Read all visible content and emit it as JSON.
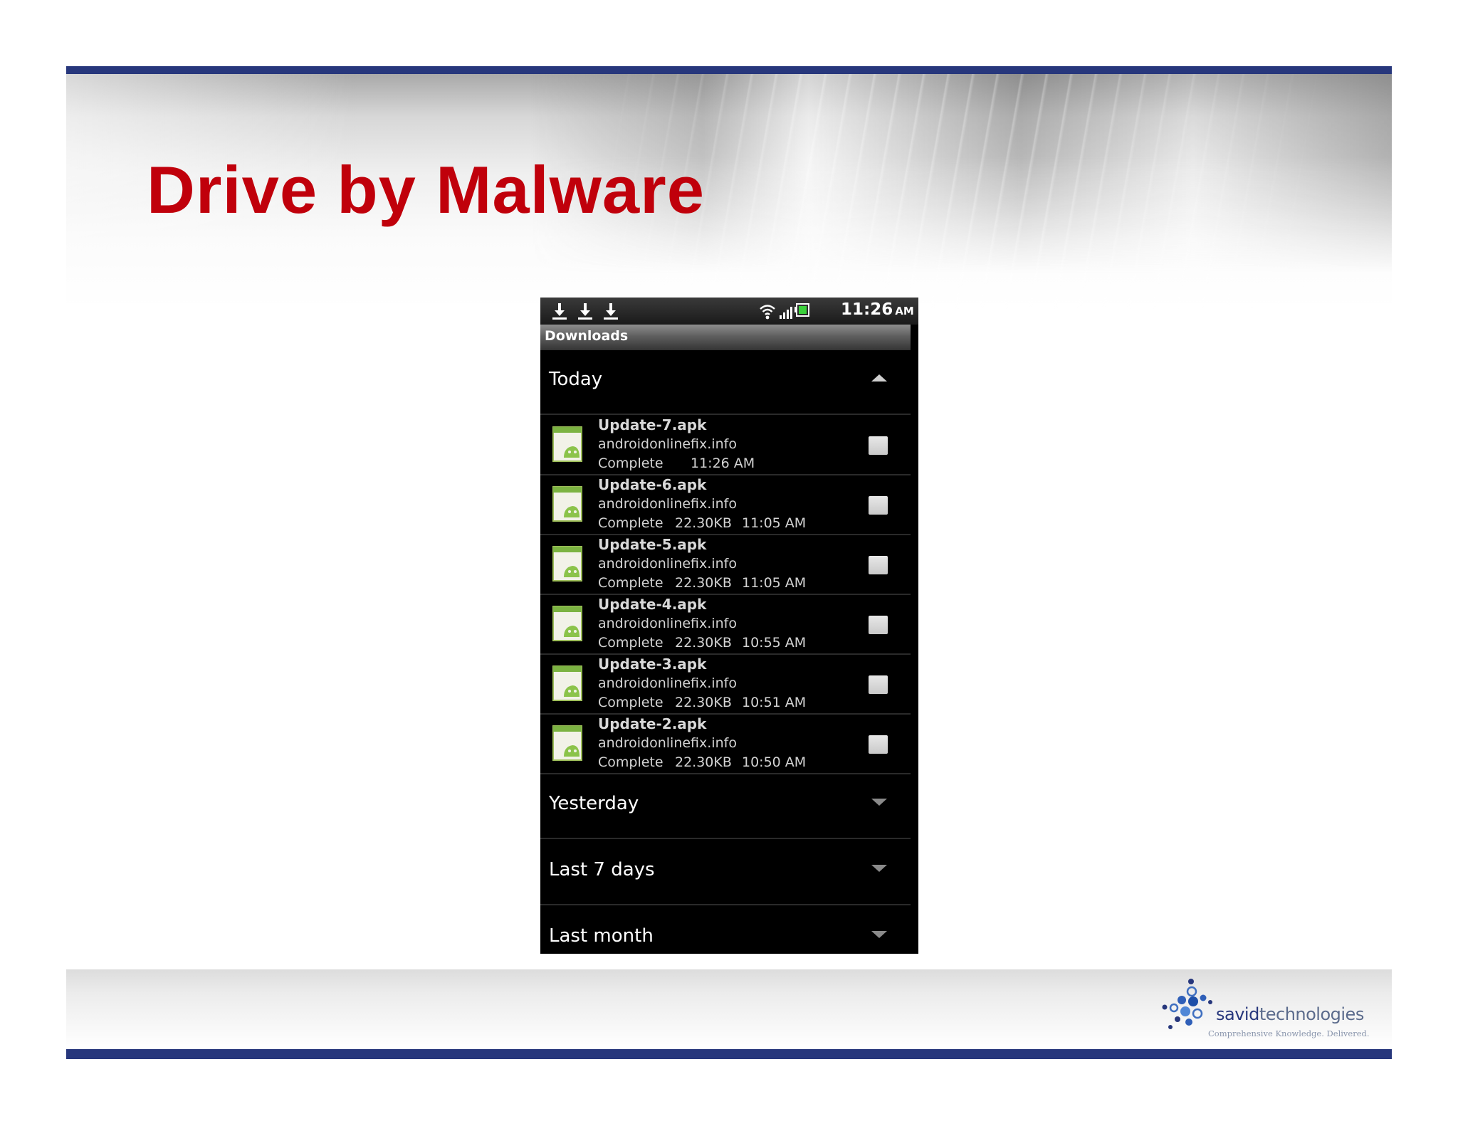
{
  "slide": {
    "title": "Drive by Malware",
    "accent_color": "#c0000b",
    "bar_color": "#27377c"
  },
  "phone": {
    "status_bar": {
      "notification_icons": [
        "download-icon",
        "download-icon",
        "download-icon"
      ],
      "system_icons": [
        "wifi-icon",
        "signal-icon",
        "battery-icon"
      ],
      "time": "11:26",
      "ampm": "AM"
    },
    "screen_title": "Downloads",
    "groups": {
      "today": {
        "label": "Today",
        "expanded": true,
        "toggle_icon": "chevron-up-icon"
      },
      "yesterday": {
        "label": "Yesterday",
        "expanded": false,
        "toggle_icon": "chevron-down-icon"
      },
      "last7": {
        "label": "Last 7 days",
        "expanded": false,
        "toggle_icon": "chevron-down-icon"
      },
      "lastmonth": {
        "label": "Last month",
        "expanded": false,
        "toggle_icon": "chevron-down-icon"
      }
    },
    "downloads": [
      {
        "name": "Update-7.apk",
        "source": "androidonlinefix.info",
        "status": "Complete",
        "size": "",
        "time": "11:26 AM",
        "checked": false
      },
      {
        "name": "Update-6.apk",
        "source": "androidonlinefix.info",
        "status": "Complete",
        "size": "22.30KB",
        "time": "11:05 AM",
        "checked": false
      },
      {
        "name": "Update-5.apk",
        "source": "androidonlinefix.info",
        "status": "Complete",
        "size": "22.30KB",
        "time": "11:05 AM",
        "checked": false
      },
      {
        "name": "Update-4.apk",
        "source": "androidonlinefix.info",
        "status": "Complete",
        "size": "22.30KB",
        "time": "10:55 AM",
        "checked": false
      },
      {
        "name": "Update-3.apk",
        "source": "androidonlinefix.info",
        "status": "Complete",
        "size": "22.30KB",
        "time": "10:51 AM",
        "checked": false
      },
      {
        "name": "Update-2.apk",
        "source": "androidonlinefix.info",
        "status": "Complete",
        "size": "22.30KB",
        "time": "10:50 AM",
        "checked": false
      }
    ]
  },
  "logo": {
    "word_bold": "savid",
    "word_rest": "technologies",
    "tagline": "Comprehensive Knowledge. Delivered."
  }
}
